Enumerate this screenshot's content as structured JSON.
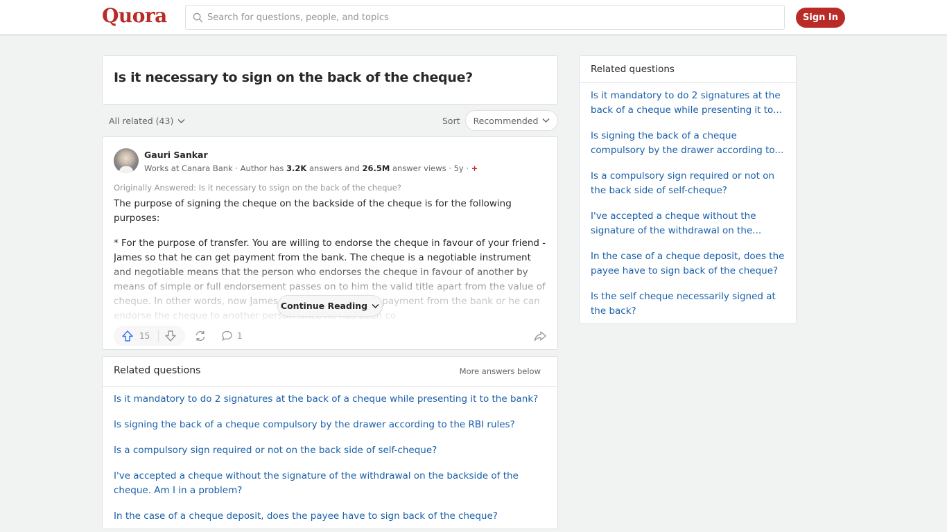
{
  "header": {
    "logo": "Quora",
    "search_placeholder": "Search for questions, people, and topics",
    "signin_label": "Sign In",
    "brand_color": "#b92b27"
  },
  "question": {
    "title": "Is it necessary to sign on the back of the cheque?"
  },
  "filters": {
    "all_related": "All related (43)",
    "sort_label": "Sort",
    "sort_value": "Recommended"
  },
  "answer": {
    "author_name": "Gauri Sankar",
    "cred_prefix": "Works at Canara Bank · Author has ",
    "answers_count": "3.2K",
    "cred_mid": " answers and ",
    "views_count": "26.5M",
    "cred_suffix": " answer views · 5y · ",
    "plus_badge": "+",
    "originally_answered": "Originally Answered: Is it necessary to ssign on the back of the cheque?",
    "paragraphs": [
      "The purpose of signing the cheque on the backside of the cheque is for the following purposes:",
      "* For the purpose of transfer. You are willing to endorse the cheque in favour of your friend - James so that he can get payment from the bank. The cheque is a negotiable instrument and negotiable means that the person who endorses the cheque in favour of another by means of simple or full endorsement passes on to him the valid title apart from the value of cheque. In other words, now James has the option to get payment from the bank or he can endorse the cheque to another person since he has been co"
    ],
    "continue_label": "Continue Reading",
    "upvotes": "15",
    "comments": "1"
  },
  "related_main": {
    "title": "Related questions",
    "more_label": "More answers below",
    "items": [
      "Is it mandatory to do 2 signatures at the back of a cheque while presenting it to the bank?",
      "Is signing the back of a cheque compulsory by the drawer according to the RBI rules?",
      "Is a compulsory sign required or not on the back side of self-cheque?",
      "I've accepted a cheque without the signature of the withdrawal on the backside of the cheque. Am I in a problem?",
      "In the case of a cheque deposit, does the payee have to sign back of the cheque?"
    ]
  },
  "related_side": {
    "title": "Related questions",
    "items": [
      "Is it mandatory to do 2 signatures at the back of a cheque while presenting it to...",
      "Is signing the back of a cheque compulsory by the drawer according to...",
      "Is a compulsory sign required or not on the back side of self-cheque?",
      "I've accepted a cheque without the signature of the withdrawal on the...",
      "In the case of a cheque deposit, does the payee have to sign back of the cheque?",
      "Is the self cheque necessarily signed at the back?"
    ]
  }
}
